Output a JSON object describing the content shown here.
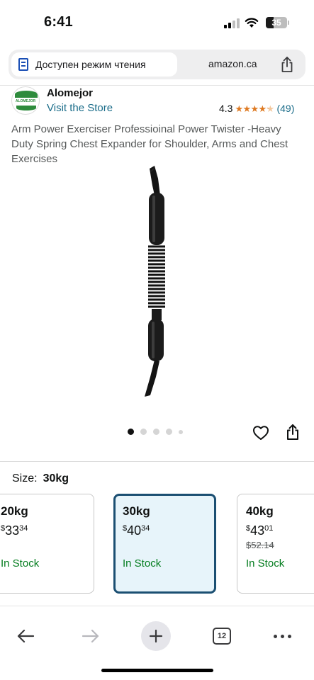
{
  "status_bar": {
    "time": "6:41",
    "battery": "35"
  },
  "browser": {
    "reader_mode_label": "Доступен режим чтения",
    "domain": "amazon.ca"
  },
  "seller": {
    "logo_text": "ALOMEJOR",
    "name": "Alomejor",
    "visit_store": "Visit the Store",
    "rating": "4.3",
    "stars_filled": 4.3,
    "review_count": "(49)"
  },
  "product": {
    "title": "Arm Power Exerciser Professioinal Power Twister -Heavy Duty Spring Chest Expander for Shoulder, Arms and Chest Exercises",
    "image_count": 5,
    "active_image": 1
  },
  "size": {
    "label": "Size:",
    "selected": "30kg",
    "options": [
      {
        "size": "20kg",
        "symbol": "$",
        "dollars": "33",
        "cents": "34",
        "old_price": "",
        "stock": "In Stock"
      },
      {
        "size": "30kg",
        "symbol": "$",
        "dollars": "40",
        "cents": "34",
        "old_price": "",
        "stock": "In Stock"
      },
      {
        "size": "40kg",
        "symbol": "$",
        "dollars": "43",
        "cents": "01",
        "old_price": "$52.14",
        "stock": "In Stock"
      }
    ]
  },
  "toolbar": {
    "tab_count": "12"
  },
  "colors": {
    "link": "#1a6c89",
    "star": "#de7921",
    "in_stock": "#047d1f",
    "selected_border": "#1b4f72",
    "selected_bg": "#e7f4fa"
  }
}
